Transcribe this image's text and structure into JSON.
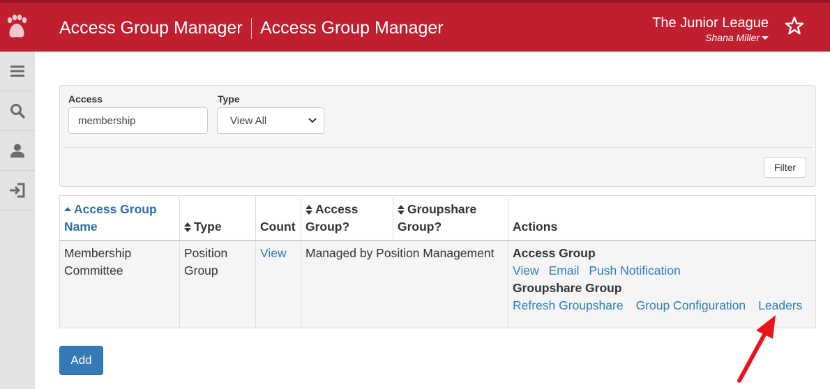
{
  "colors": {
    "header": "#c01f30",
    "link": "#337ab7",
    "annotation": "#e8141c"
  },
  "header": {
    "title": "Access Group Manager",
    "subtitle": "Access Group Manager",
    "organization": "The Junior League",
    "user": "Shana Miller"
  },
  "sidebar": {
    "items": [
      {
        "icon": "menu-icon"
      },
      {
        "icon": "search-icon"
      },
      {
        "icon": "user-icon"
      },
      {
        "icon": "logout-icon"
      }
    ]
  },
  "filters": {
    "access_label": "Access",
    "access_value": "membership",
    "type_label": "Type",
    "type_selected": "View All",
    "filter_button": "Filter"
  },
  "table": {
    "headers": {
      "name_line1": "Access Group",
      "name_line2": "Name",
      "type": "Type",
      "count": "Count",
      "access_line1": "Access",
      "access_line2": "Group?",
      "groupshare_line1": "Groupshare",
      "groupshare_line2": "Group?",
      "actions": "Actions"
    },
    "rows": [
      {
        "name_line1": "Membership",
        "name_line2": "Committee",
        "type_line1": "Position",
        "type_line2": "Group",
        "count_link": "View",
        "access_group": "Managed by Position Management",
        "groupshare_group": "",
        "actions": {
          "access_heading": "Access Group",
          "access_links": [
            "View",
            "Email",
            "Push Notification"
          ],
          "groupshare_heading": "Groupshare Group",
          "groupshare_links": [
            "Refresh Groupshare",
            "Group Configuration",
            "Leaders"
          ]
        }
      }
    ]
  },
  "add_button": "Add"
}
